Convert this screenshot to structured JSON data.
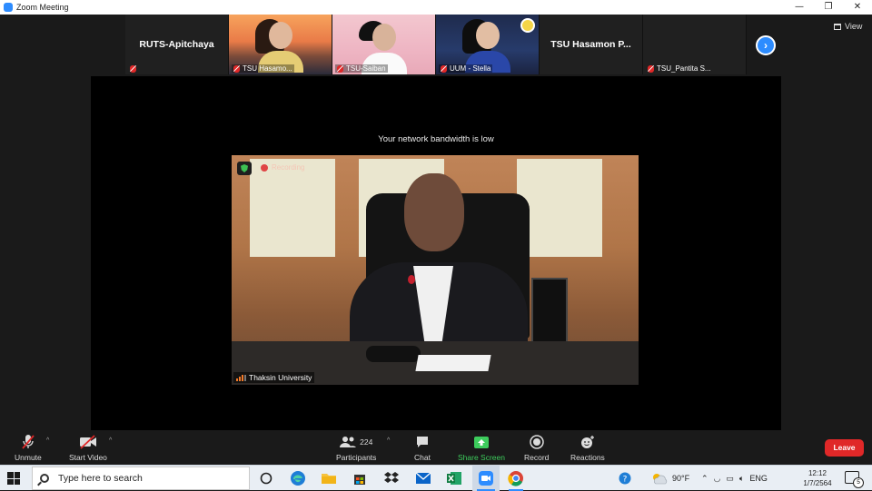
{
  "window": {
    "title": "Zoom Meeting",
    "minimize": "—",
    "restore": "❐",
    "close": "✕"
  },
  "gallery": {
    "tiles": [
      {
        "name": "RUTS-Apitchaya",
        "video": false
      },
      {
        "name": "TSU Hasamo...",
        "video": true
      },
      {
        "name": "TSU-Saiban",
        "video": true
      },
      {
        "name": "UUM - Stella",
        "video": true
      },
      {
        "name": "TSU Hasamon P...",
        "video": false
      },
      {
        "name": "TSU_Pantita S...",
        "video": false
      }
    ],
    "next_arrow": "›",
    "view_label": "View"
  },
  "stage": {
    "bandwidth_message": "Your network bandwidth is low",
    "recording_label": "Recording",
    "speaker_name": "Thaksin University"
  },
  "toolbar": {
    "unmute": "Unmute",
    "start_video": "Start Video",
    "participants": "Participants",
    "participants_count": "224",
    "chat": "Chat",
    "share_screen": "Share Screen",
    "record": "Record",
    "reactions": "Reactions",
    "leave": "Leave",
    "caret": "^"
  },
  "taskbar": {
    "search_placeholder": "Type here to search",
    "weather": "90°F",
    "language": "ENG",
    "time": "12:12",
    "date": "1/7/2564",
    "notifications": "5"
  },
  "colors": {
    "zoom_blue": "#2d8cff",
    "leave_red": "#e02828",
    "share_green": "#3dcc5c",
    "mic_muted_red": "#e02828"
  }
}
